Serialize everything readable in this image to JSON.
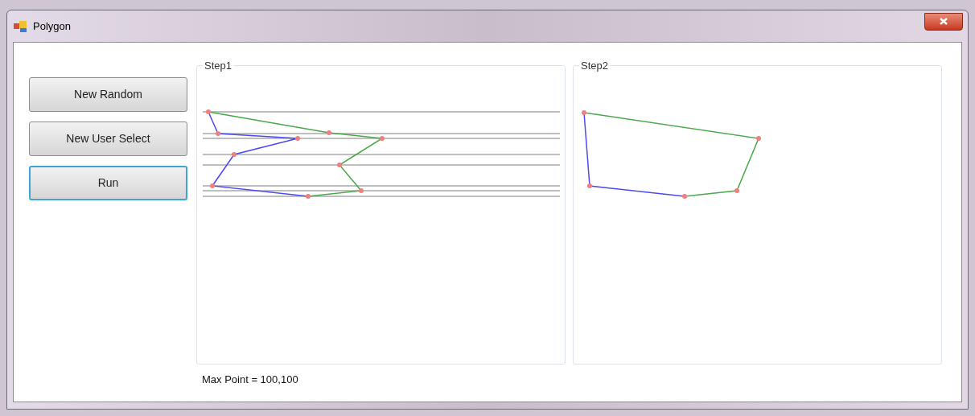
{
  "window": {
    "title": "Polygon"
  },
  "buttons": [
    {
      "label": "New Random",
      "focused": false
    },
    {
      "label": "New User Select",
      "focused": false
    },
    {
      "label": "Run",
      "focused": true
    }
  ],
  "groups": [
    {
      "title": "Step1",
      "kind": "scan"
    },
    {
      "title": "Step2",
      "kind": "hull"
    }
  ],
  "status": "Max Point = 100,100"
}
